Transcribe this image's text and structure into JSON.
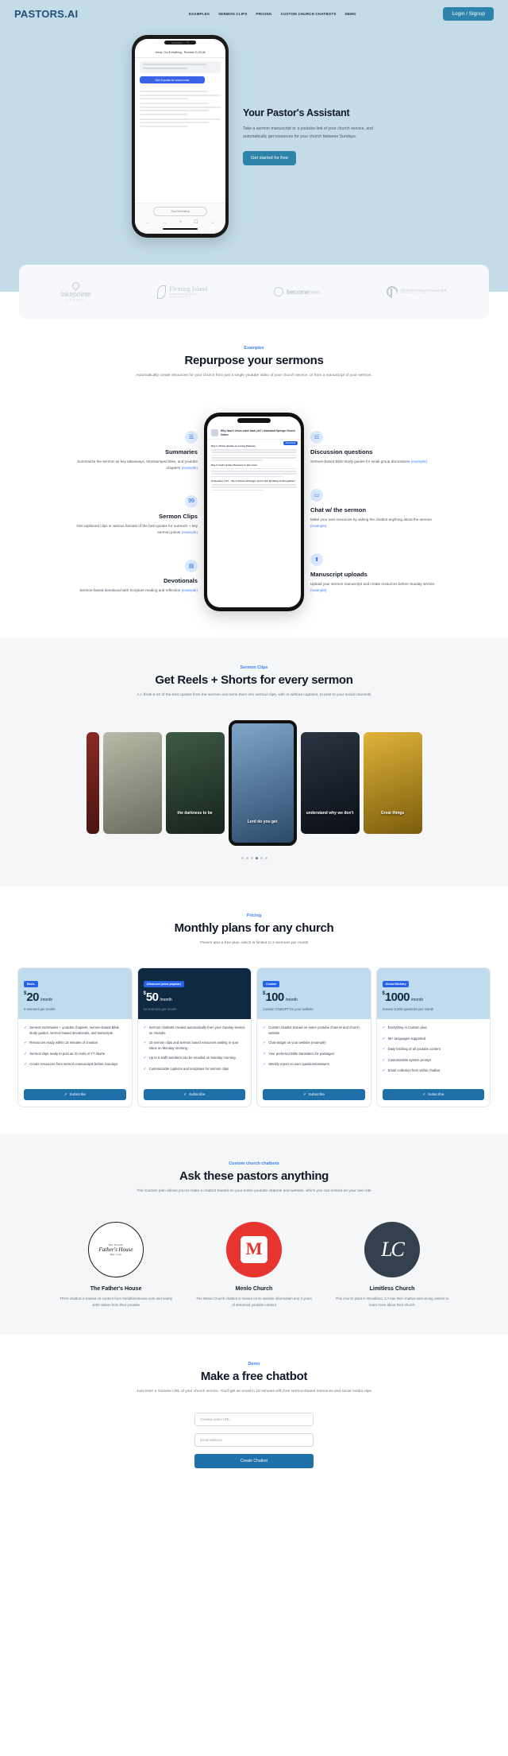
{
  "brand": "PASTORS.AI",
  "nav": {
    "links": [
      {
        "label": "EXAMPLES"
      },
      {
        "label": "SERMON CLIPS"
      },
      {
        "label": "PRICING"
      },
      {
        "label": "CUSTOM CHURCH CHATBOTS"
      },
      {
        "label": "DEMO"
      }
    ],
    "login_label": "Login / Signup"
  },
  "hero": {
    "title": "Your Pastor's Assistant",
    "subtitle": "Take a sermon manuscript or a youtube link of your church service, and automatically get resources for your church between Sundays.",
    "cta_label": "Get started for free",
    "phone": {
      "header": "Jesus. Our Everything - Romans 11:33-36",
      "question": "I'm an AI assistant for the pastor that gave this sermon. Do you have any questions about it?",
      "action_pill": "Give 5 quotes for social media"
    }
  },
  "logos": [
    {
      "name": "lakepointe",
      "sub": "CHURCH"
    },
    {
      "name": "Fleming Island",
      "sub": "United Methodist Church",
      "sub2": "ESTABLISHED 1874"
    },
    {
      "name_bold": "become",
      "name_light": "new"
    },
    {
      "name": "CHRISTIANLIFECENTER",
      "sub": "MANKATO, MN"
    }
  ],
  "examples": {
    "eyebrow": "Examples",
    "title": "Repurpose your sermons",
    "subtitle": "Automatically create resources for your church from just a single youtube video of your church service, or from a manuscript of your sermon.",
    "left_features": [
      {
        "icon": "document-icon",
        "glyph": "☰",
        "title": "Summaries",
        "body": "Summarize the sermon w/ key takeaways, timestamped links, and youtube chapters ",
        "link": "(example)"
      },
      {
        "icon": "quote-icon",
        "glyph": "99",
        "title": "Sermon Clips",
        "body": "Get captioned clips in various formats of the best quotes for outreach + key sermon points ",
        "link": "(example)"
      },
      {
        "icon": "book-icon",
        "glyph": "▤",
        "title": "Devotionals",
        "body": "Sermon-based devotional with Scripture reading and reflection ",
        "link": "(example)"
      }
    ],
    "right_features": [
      {
        "icon": "list-icon",
        "glyph": "☷",
        "title": "Discussion questions",
        "body": "Sermon-based Bible study guides for small group discussions ",
        "link": "(example)"
      },
      {
        "icon": "chat-icon",
        "glyph": "▭",
        "title": "Chat w/ the sermon",
        "body": "Make your own resources by asking the chatbot anything about the sermon ",
        "link": "(example)"
      },
      {
        "icon": "upload-icon",
        "glyph": "⬆",
        "title": "Manuscript uploads",
        "body": "Upload your sermon manuscript and create resources before Sunday service ",
        "link": "(example)"
      }
    ],
    "phone": {
      "title": "Why hasn't Jesus come back yet? | Abundant Springs Church Online",
      "tag": "Devotional",
      "day1": "Day 1: Divine Justice as Loving Patience",
      "day2": "Day 2: God's Active Presence in Our Lives",
      "day3": "Colossians 1:17 - \"He is before all things, and in him all things hold together.\""
    }
  },
  "reels": {
    "eyebrow": "Sermon Clips",
    "title": "Get Reels + Shorts for every sermon",
    "subtitle": "A.I. finds 5-10 of the best quotes from the sermon and turns them into vertical clips, with or without captions, to post to your social channels",
    "clips": [
      {
        "caption": "",
        "color1": "#8a2a24",
        "color2": "#4a1410"
      },
      {
        "caption": "",
        "color1": "#9aa08c",
        "color2": "#5c6050"
      },
      {
        "caption": "the darkness to be",
        "color1": "#2f4436",
        "color2": "#16241c"
      },
      {
        "caption": "Lord do you get",
        "color1": "#6b8fb5",
        "color2": "#2b4a6b"
      },
      {
        "caption": "understand why we don't",
        "color1": "#1a2230",
        "color2": "#0b0f16"
      },
      {
        "caption": "Great things",
        "color1": "#d4a017",
        "color2": "#7a5c0b"
      }
    ],
    "dot_count": 6,
    "active_dot": 3
  },
  "pricing": {
    "eyebrow": "Pricing",
    "title": "Monthly plans for any church",
    "subtitle": "There's also a free plan, which is limited to 2 sermons per month",
    "plans": [
      {
        "badge": "Basic",
        "currency": "$",
        "amount": "20",
        "per": "/month",
        "note": "5 sermons per month",
        "dark": false,
        "features": [
          "Sermon summaries + youtube chapters, sermon-based Bible study guides, sermon-based devotionals, and transcripts",
          "Resources ready within 15 minutes of creation",
          "Sermon clips ready to post as IG reels or YT shorts",
          "Create resources from sermon manuscripts before Sundays"
        ],
        "cta": "Subscribe"
      },
      {
        "badge": "Advanced (most popular)",
        "currency": "$",
        "amount": "50",
        "per": "/month",
        "note": "10 sermons per month",
        "dark": true,
        "features": [
          "Sermon chatbots created automatically from your Sunday service on Youtube",
          "10 sermon clips and sermon based resources waiting in your inbox on Monday morning",
          "Up to 5 staff members can be emailed on Monday morning",
          "Customizable captions and templates for sermon clips"
        ],
        "cta": "Subscribe"
      },
      {
        "badge": "Custom",
        "currency": "$",
        "amount": "100",
        "per": "/month",
        "note": "Custom ChatGPT for your website",
        "dark": false,
        "features": [
          "Custom chatbot trained on entire youtube channel and church website",
          "Chat widget on your website (example)",
          "Your preferred Bible translation for passages",
          "Weekly report on user questions/answers"
        ],
        "cta": "Subscribe"
      },
      {
        "badge": "Global Ministry",
        "currency": "$",
        "amount": "1000",
        "per": "/month",
        "note": "Answer 5,000 questions per month",
        "dark": false,
        "features": [
          "Everything in Custom plus:",
          "95+ languages supported",
          "Daily fetching of all youtube content",
          "Customizable system prompt",
          "Email collection form within chatbot"
        ],
        "cta": "Subscribe"
      }
    ]
  },
  "chatbots": {
    "eyebrow": "Custom church chatbots",
    "title": "Ask these pastors anything",
    "subtitle": "The Custom plan allows you to make a chatbot trained on your entire youtube channel and website, which you can embed on your own site",
    "churches": [
      {
        "logo": "fathers-house-logo",
        "logo_top": "Our People",
        "logo_main": "Father's House",
        "logo_bot": "Our City",
        "name": "The Father's House",
        "body": "TFH's chatbot is trained on content from thefathershouse.com and nearly 1000 videos from their youtube"
      },
      {
        "logo": "menlo-church-logo",
        "logo_main": "M",
        "name": "Menlo Church",
        "body": "The Menlo Church chatbot is trained on its website information and 3 years of streamed youtube content"
      },
      {
        "logo": "limitless-church-logo",
        "logo_main": "LC",
        "name": "Limitless Church",
        "body": "This church plant in Woodland, CA has their chatbot welcoming visitors to learn more about their church"
      }
    ]
  },
  "demo": {
    "eyebrow": "Demo",
    "title": "Make a free chatbot",
    "subtitle": "Just enter a Youtube URL of your church service. You'll get an email in 15 minutes with free sermon-based resources and social media clips",
    "url_placeholder": "Youtube video URL",
    "email_placeholder": "Email address",
    "submit_label": "Create Chatbot"
  }
}
